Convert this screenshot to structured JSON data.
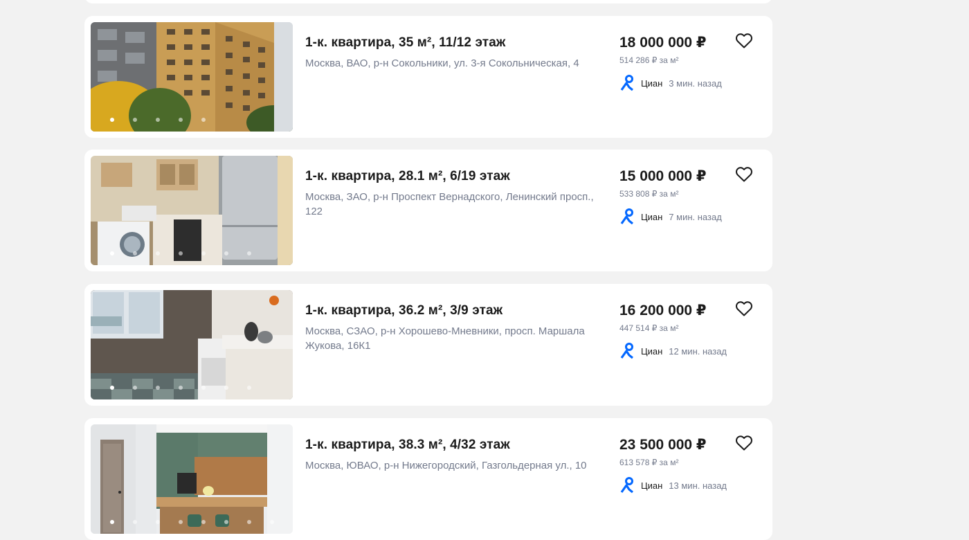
{
  "colors": {
    "background": "#f2f2f2",
    "card": "#ffffff",
    "accent": "#0468ff",
    "muted": "#737a8c"
  },
  "listings": [
    {
      "title": "1-к. квартира, 35 м², 11/12 этаж",
      "address": "Москва, ВАО, р-н Сокольники, ул. 3-я Сокольническая, 4",
      "price": "18 000 000 ₽",
      "price_per_m2": "514 286 ₽ за м²",
      "source": "Циан",
      "time": "3 мин. назад",
      "photo_icon": "apartment-building-photo",
      "photo_count": 5,
      "active_photo": 0
    },
    {
      "title": "1-к. квартира, 28.1 м², 6/19 этаж",
      "address": "Москва, ЗАО, р-н Проспект Вернадского, Ленинский просп., 122",
      "price": "15 000 000 ₽",
      "price_per_m2": "533 808 ₽ за м²",
      "source": "Циан",
      "time": "7 мин. назад",
      "photo_icon": "kitchen-photo",
      "photo_count": 7,
      "active_photo": 0
    },
    {
      "title": "1-к. квартира, 36.2 м², 3/9 этаж",
      "address": "Москва, СЗАО, р-н Хорошево-Мневники, просп. Маршала Жукова, 16К1",
      "price": "16 200 000 ₽",
      "price_per_m2": "447 514 ₽ за м²",
      "source": "Циан",
      "time": "12 мин. назад",
      "photo_icon": "kitchen-window-photo",
      "photo_count": 7,
      "active_photo": 0
    },
    {
      "title": "1-к. квартира, 38.3 м², 4/32 этаж",
      "address": "Москва, ЮВАО, р-н Нижегородский, Газгольдерная ул., 10",
      "price": "23 500 000 ₽",
      "price_per_m2": "613 578 ₽ за м²",
      "source": "Циан",
      "time": "13 мин. назад",
      "photo_icon": "studio-kitchen-photo",
      "photo_count": 8,
      "active_photo": 0
    }
  ]
}
